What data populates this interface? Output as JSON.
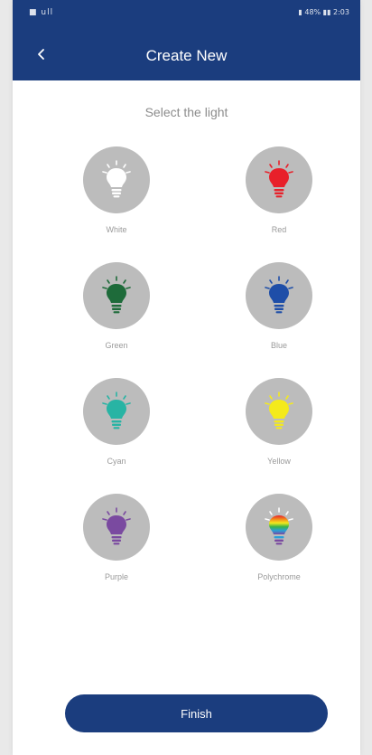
{
  "status_bar": {
    "left": "■ ull",
    "right": "▮ 48% ▮▮ 2:03"
  },
  "header": {
    "title": "Create New",
    "back_icon": "chevron-left-icon"
  },
  "subtitle": "Select the light",
  "lights": [
    {
      "label": "White",
      "color": "#ffffff"
    },
    {
      "label": "Red",
      "color": "#e8202a"
    },
    {
      "label": "Green",
      "color": "#1e6b3a"
    },
    {
      "label": "Blue",
      "color": "#1e4ea8"
    },
    {
      "label": "Cyan",
      "color": "#28b4a4"
    },
    {
      "label": "Yellow",
      "color": "#f4ea1c"
    },
    {
      "label": "Purple",
      "color": "#7a4aa0"
    },
    {
      "label": "Polychrome",
      "color": "rainbow"
    }
  ],
  "colors": {
    "primary": "#1b3d7e",
    "circle_bg": "#bcbcbc",
    "label_text": "#9a9a9a"
  },
  "finish_label": "Finish"
}
